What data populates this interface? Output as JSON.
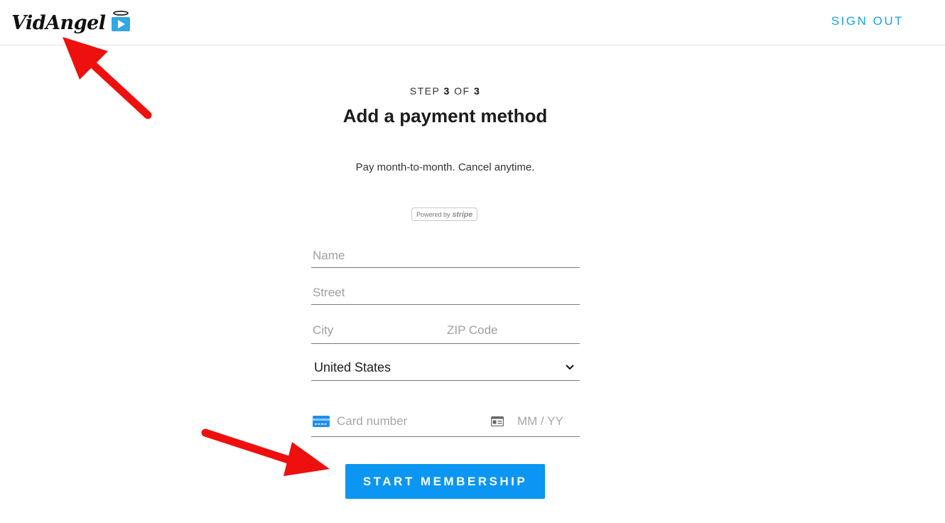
{
  "header": {
    "logo_text": "VidAngel",
    "signout_label": "SIGN OUT"
  },
  "form": {
    "step_word": "STEP",
    "step_current": "3",
    "step_of": "OF",
    "step_total": "3",
    "title": "Add a payment method",
    "subtitle": "Pay month-to-month. Cancel anytime.",
    "stripe_badge_prefix": "Powered by",
    "stripe_badge_brand": "stripe",
    "name_placeholder": "Name",
    "street_placeholder": "Street",
    "city_placeholder": "City",
    "zip_placeholder": "ZIP Code",
    "country_value": "United States",
    "card_placeholder": "Card number",
    "expiry_placeholder": "MM / YY",
    "submit_label": "START MEMBERSHIP"
  },
  "colors": {
    "accent": "#1aa0e8",
    "button": "#0a96f2",
    "annotation_arrow": "#ee0f0f"
  },
  "icons": [
    "play-badge-icon",
    "chevron-down-icon",
    "credit-card-icon",
    "id-card-icon",
    "annotation-arrow-icon"
  ]
}
